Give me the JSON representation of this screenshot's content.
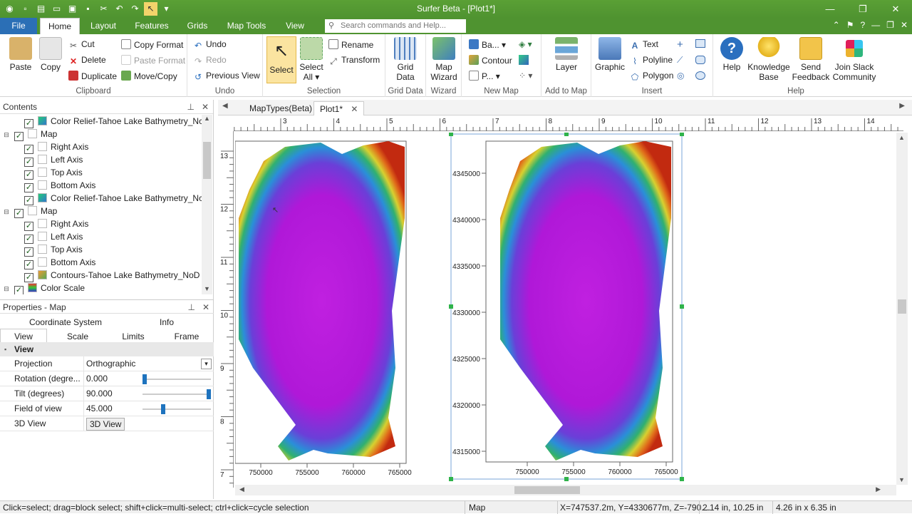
{
  "window": {
    "title": "Surfer Beta - [Plot1*]",
    "minimize": "—",
    "restore": "❐",
    "close": "✕"
  },
  "tabs": {
    "file": "File",
    "home": "Home",
    "layout": "Layout",
    "features": "Features",
    "grids": "Grids",
    "map_tools": "Map Tools",
    "view": "View",
    "search_placeholder": "Search commands and Help..."
  },
  "ribbon": {
    "clipboard": {
      "label": "Clipboard",
      "paste": "Paste",
      "copy": "Copy",
      "cut": "Cut",
      "delete": "Delete",
      "duplicate": "Duplicate",
      "copy_format": "Copy Format",
      "paste_format": "Paste Format",
      "move_copy": "Move/Copy"
    },
    "undo": {
      "label": "Undo",
      "undo": "Undo",
      "redo": "Redo",
      "previous_view": "Previous View"
    },
    "selection": {
      "label": "Selection",
      "select": "Select",
      "select_all_1": "Select",
      "select_all_2": "All ▾",
      "rename": "Rename",
      "transform": "Transform"
    },
    "grid_data": {
      "label": "Grid Data",
      "btn_1": "Grid",
      "btn_2": "Data"
    },
    "wizard": {
      "label": "Wizard",
      "btn_1": "Map",
      "btn_2": "Wizard"
    },
    "new_map": {
      "label": "New Map",
      "base": "Ba...",
      "contour": "Contour",
      "post": "P..."
    },
    "add_to_map": {
      "label": "Add to Map",
      "layer": "Layer"
    },
    "insert": {
      "label": "Insert",
      "graphic": "Graphic",
      "text": "Text",
      "polyline": "Polyline",
      "polygon": "Polygon"
    },
    "help": {
      "label": "Help",
      "help": "Help",
      "kb_1": "Knowledge",
      "kb_2": "Base",
      "fb_1": "Send",
      "fb_2": "Feedback",
      "slack_1": "Join Slack",
      "slack_2": "Community"
    }
  },
  "contents": {
    "title": "Contents",
    "items": [
      {
        "label": "Color Relief-Tahoe Lake Bathymetry_Nc",
        "level": 2,
        "checked": true
      },
      {
        "label": "Map",
        "level": 1,
        "checked": true
      },
      {
        "label": "Right Axis",
        "level": 2,
        "checked": true
      },
      {
        "label": "Left Axis",
        "level": 2,
        "checked": true
      },
      {
        "label": "Top Axis",
        "level": 2,
        "checked": true
      },
      {
        "label": "Bottom Axis",
        "level": 2,
        "checked": true
      },
      {
        "label": "Color Relief-Tahoe Lake Bathymetry_Nc",
        "level": 2,
        "checked": true
      },
      {
        "label": "Map",
        "level": 1,
        "checked": true
      },
      {
        "label": "Right Axis",
        "level": 2,
        "checked": true
      },
      {
        "label": "Left Axis",
        "level": 2,
        "checked": true
      },
      {
        "label": "Top Axis",
        "level": 2,
        "checked": true
      },
      {
        "label": "Bottom Axis",
        "level": 2,
        "checked": true
      },
      {
        "label": "Contours-Tahoe Lake Bathymetry_NoD",
        "level": 2,
        "checked": true
      },
      {
        "label": "Color Scale",
        "level": 1,
        "checked": true
      }
    ]
  },
  "properties": {
    "title": "Properties - Map",
    "tabs_top": [
      "Coordinate System",
      "Info"
    ],
    "tabs_bottom": [
      "View",
      "Scale",
      "Limits",
      "Frame"
    ],
    "section": "View",
    "rows": [
      {
        "key": "Projection",
        "value": "Orthographic"
      },
      {
        "key": "Rotation (degre...",
        "value": "0.000",
        "level": 0.0
      },
      {
        "key": "Tilt (degrees)",
        "value": "90.000",
        "level": 1.0
      },
      {
        "key": "Field of view",
        "value": "45.000",
        "level": 0.29
      },
      {
        "key": "3D View",
        "value": "3D View"
      }
    ]
  },
  "document": {
    "tabs": [
      "MapTypes(Beta)",
      "Plot1*"
    ],
    "ruler_h": [
      "3",
      "4",
      "5",
      "6",
      "7",
      "8",
      "9",
      "10",
      "11",
      "12",
      "13",
      "14"
    ],
    "ruler_v": [
      "13",
      "12",
      "11",
      "10",
      "9",
      "8",
      "7"
    ],
    "map1_x_ticks": [
      "750000",
      "755000",
      "760000",
      "765000"
    ],
    "map2_x_ticks": [
      "750000",
      "755000",
      "760000",
      "765000"
    ],
    "map2_y_ticks": [
      "4345000",
      "4340000",
      "4335000",
      "4330000",
      "4325000",
      "4320000",
      "4315000"
    ]
  },
  "status": {
    "hint": "Click=select; drag=block select; shift+click=multi-select; ctrl+click=cycle selection",
    "object": "Map",
    "coords": "X=747537.2m, Y=4330677m, Z=-790....",
    "position": "2.14 in, 10.25 in",
    "size": "4.26 in x 6.35 in"
  }
}
